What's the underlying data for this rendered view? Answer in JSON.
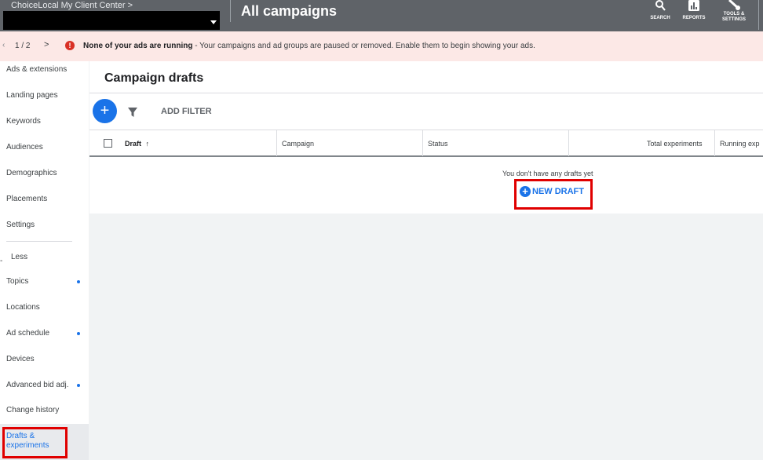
{
  "header": {
    "client_center": "ChoiceLocal My Client Center  >",
    "title": "All campaigns",
    "tools": [
      {
        "label": "SEARCH",
        "icon": "search-icon"
      },
      {
        "label": "REPORTS",
        "icon": "reports-icon"
      },
      {
        "label_line1": "TOOLS &",
        "label_line2": "SETTINGS",
        "icon": "wrench-icon"
      }
    ]
  },
  "alert": {
    "prev": "‹",
    "pager": "1 / 2",
    "next": ">",
    "icon": "error-icon",
    "bold": "None of your ads are running",
    "text": " - Your campaigns and ad groups are paused or removed. Enable them to begin showing your ads."
  },
  "sidebar": {
    "items": [
      {
        "label": "Ads & extensions"
      },
      {
        "label": "Landing pages"
      },
      {
        "label": "Keywords"
      },
      {
        "label": "Audiences"
      },
      {
        "label": "Demographics"
      },
      {
        "label": "Placements"
      },
      {
        "label": "Settings"
      },
      {
        "label": "Less"
      },
      {
        "label": "Topics",
        "dot": true
      },
      {
        "label": "Locations"
      },
      {
        "label": "Ad schedule",
        "dot": true
      },
      {
        "label": "Devices"
      },
      {
        "label": "Advanced bid adj.",
        "dot": true
      },
      {
        "label": "Change history"
      }
    ],
    "selected_line1": "Drafts &",
    "selected_line2": "experiments"
  },
  "main": {
    "title": "Campaign drafts",
    "add_button": "+",
    "add_filter": "ADD FILTER",
    "columns": [
      "Draft",
      "Campaign",
      "Status",
      "Total experiments",
      "Running exp"
    ],
    "sort_arrow": "↑",
    "empty_message": "You don't have any drafts yet",
    "new_draft": "NEW DRAFT",
    "new_draft_icon": "+"
  },
  "colors": {
    "accent": "#1a73e8",
    "header_bg": "#5f6368",
    "alert_bg": "#fce8e6",
    "error": "#d93025",
    "highlight_box": "#e00000"
  }
}
